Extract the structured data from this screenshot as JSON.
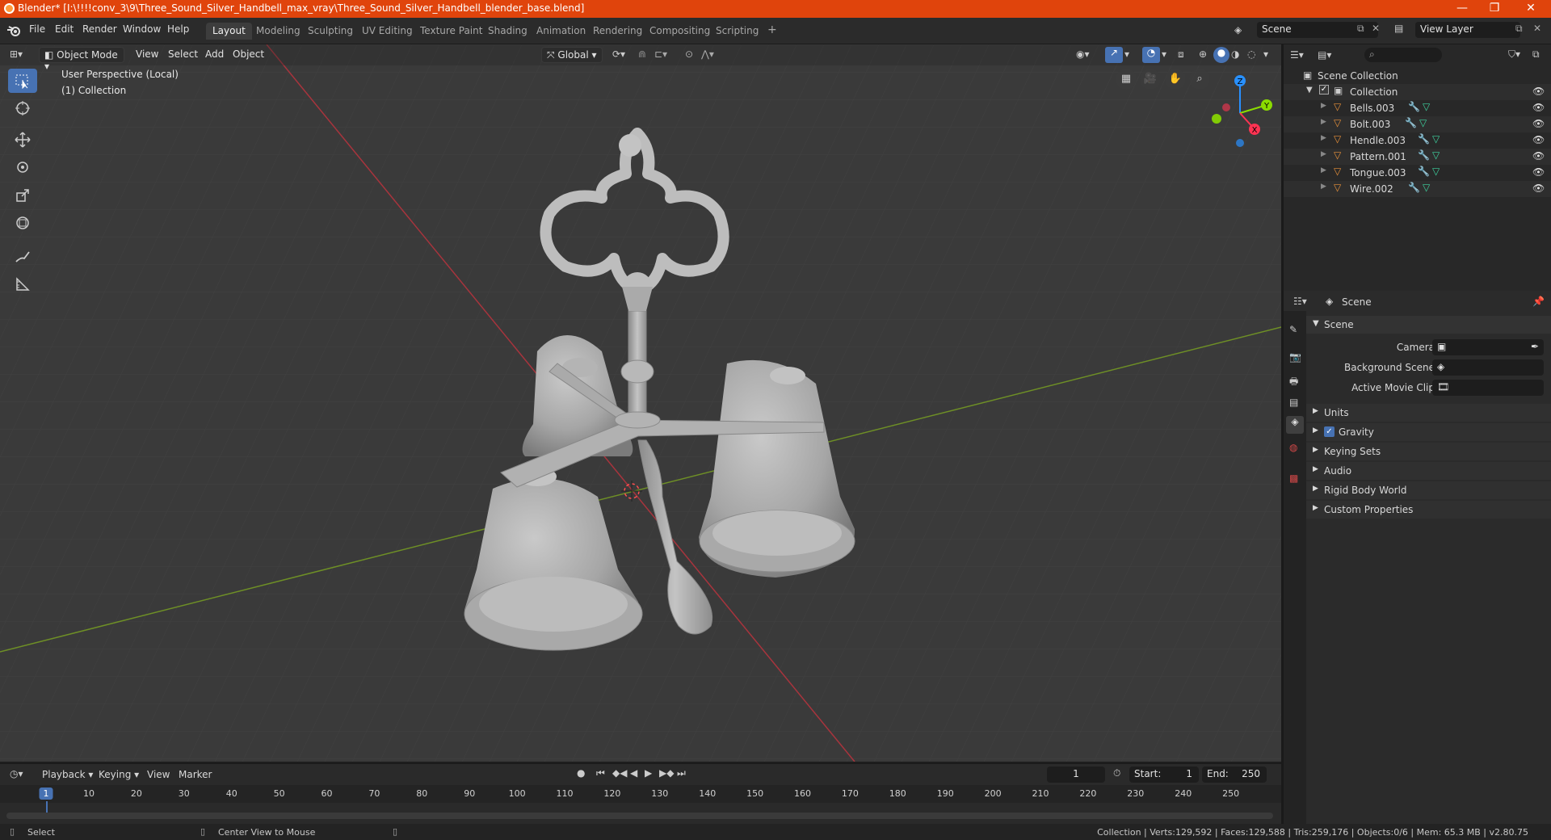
{
  "window": {
    "title": "Blender* [I:\\!!!!conv_3\\9\\Three_Sound_Silver_Handbell_max_vray\\Three_Sound_Silver_Handbell_blender_base.blend]",
    "minimize": "—",
    "maximize": "❐",
    "close": "✕"
  },
  "menubar": {
    "items": [
      "File",
      "Edit",
      "Render",
      "Window",
      "Help"
    ]
  },
  "workspaces": [
    "Layout",
    "Modeling",
    "Sculpting",
    "UV Editing",
    "Texture Paint",
    "Shading",
    "Animation",
    "Rendering",
    "Compositing",
    "Scripting"
  ],
  "workspace_add": "+",
  "scene_field": "Scene",
  "view_layer_field": "View Layer",
  "viewport": {
    "mode": "Object Mode",
    "menus": [
      "View",
      "Select",
      "Add",
      "Object"
    ],
    "transform_orientation": "Global",
    "overlay_line1": "User Perspective (Local)",
    "overlay_line2": "(1) Collection",
    "gizmo": {
      "x": "X",
      "y": "Y",
      "z": "Z"
    }
  },
  "outliner": {
    "search_placeholder": "",
    "root": "Scene Collection",
    "collection": "Collection",
    "objects": [
      "Bells.003",
      "Bolt.003",
      "Hendle.003",
      "Pattern.001",
      "Tongue.003",
      "Wire.002"
    ]
  },
  "properties": {
    "header": "Scene",
    "section": "Scene",
    "camera_label": "Camera",
    "background_scene_label": "Background Scene",
    "active_movie_clip_label": "Active Movie Clip",
    "panels": [
      "Units",
      "Gravity",
      "Keying Sets",
      "Audio",
      "Rigid Body World",
      "Custom Properties"
    ],
    "gravity_checked": true
  },
  "timeline": {
    "menus": [
      "Playback",
      "Keying",
      "View",
      "Marker"
    ],
    "current_frame": "1",
    "start_label": "Start:",
    "start_value": "1",
    "end_label": "End:",
    "end_value": "250",
    "ticks": [
      "1",
      "10",
      "20",
      "30",
      "40",
      "50",
      "60",
      "70",
      "80",
      "90",
      "100",
      "110",
      "120",
      "130",
      "140",
      "150",
      "160",
      "170",
      "180",
      "190",
      "200",
      "210",
      "220",
      "230",
      "240",
      "250"
    ]
  },
  "statusbar": {
    "select": "Select",
    "center_view": "Center View to Mouse",
    "stats": "Collection | Verts:129,592 | Faces:129,588 | Tris:259,176 | Objects:0/6 | Mem: 65.3 MB | v2.80.75"
  },
  "colors": {
    "title_bar": "#e0440c",
    "accent_blue": "#4772b3",
    "axis_red": "#ff3352",
    "axis_green": "#8bdc00",
    "axis_blue": "#2890ff",
    "object_orange": "#e8913a"
  }
}
